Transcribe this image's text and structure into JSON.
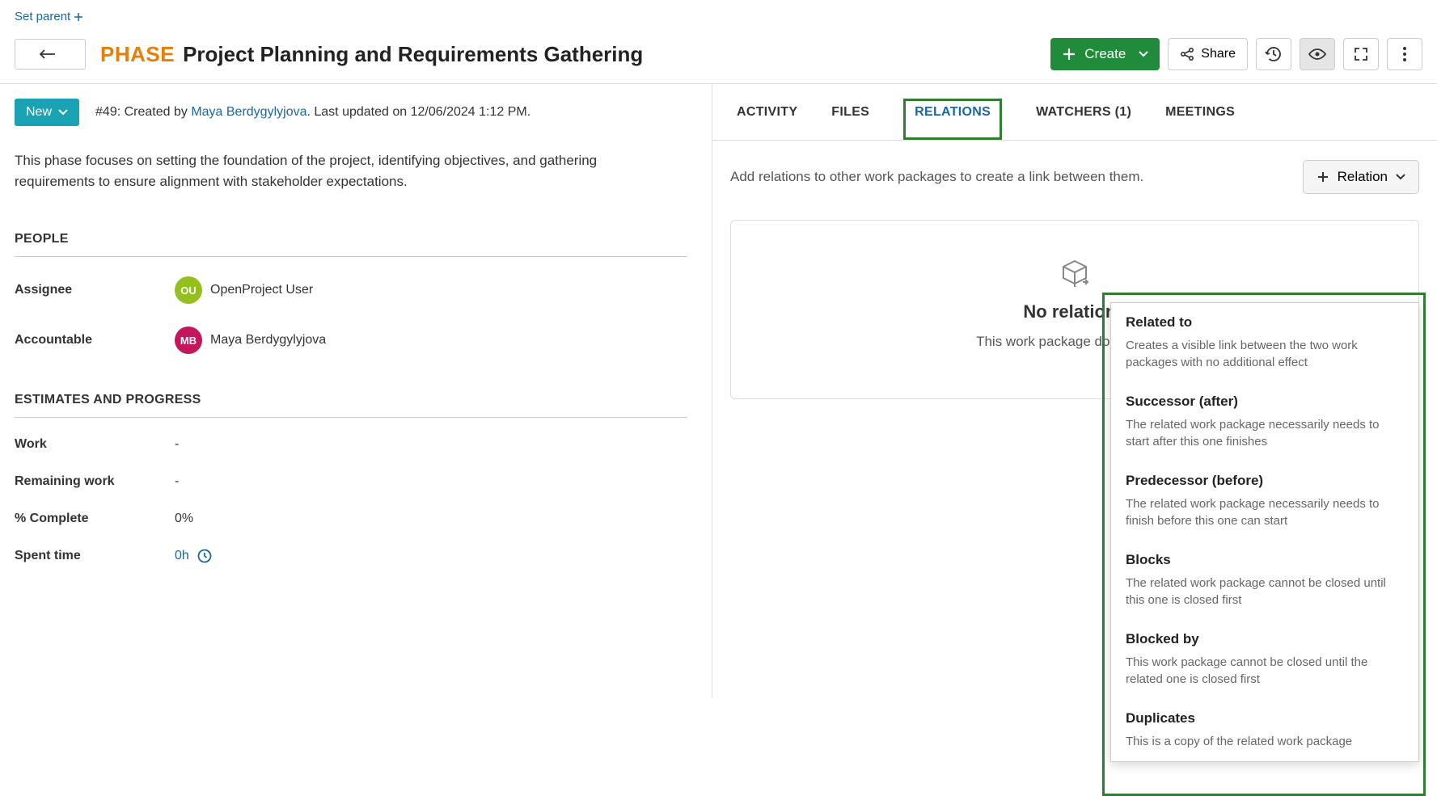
{
  "top": {
    "set_parent": "Set parent"
  },
  "header": {
    "type_label": "PHASE",
    "title": "Project Planning and Requirements Gathering",
    "create_label": "Create",
    "share_label": "Share"
  },
  "status": {
    "label": "New",
    "id_prefix": "#49: Created by ",
    "creator": "Maya Berdygylyjova",
    "updated": ". Last updated on 12/06/2024 1:12 PM."
  },
  "description": "This phase focuses on setting the foundation of the project, identifying objectives, and gathering requirements to ensure alignment with stakeholder expectations.",
  "sections": {
    "people_header": "PEOPLE",
    "assignee_label": "Assignee",
    "assignee_initials": "OU",
    "assignee_name": "OpenProject User",
    "accountable_label": "Accountable",
    "accountable_initials": "MB",
    "accountable_name": "Maya Berdygylyjova",
    "estimates_header": "ESTIMATES AND PROGRESS",
    "work_label": "Work",
    "work_value": "-",
    "remaining_label": "Remaining work",
    "remaining_value": "-",
    "complete_label": "% Complete",
    "complete_value": "0%",
    "spent_label": "Spent time",
    "spent_value": "0h"
  },
  "tabs": {
    "activity": "ACTIVITY",
    "files": "FILES",
    "relations": "RELATIONS",
    "watchers": "WATCHERS (1)",
    "meetings": "MEETINGS"
  },
  "relations": {
    "hint": "Add relations to other work packages to create a link between them.",
    "button_label": "Relation",
    "empty_title": "No relations",
    "empty_text": "This work package does not hav"
  },
  "dropdown": [
    {
      "title": "Related to",
      "desc": "Creates a visible link between the two work packages with no additional effect"
    },
    {
      "title": "Successor (after)",
      "desc": "The related work package necessarily needs to start after this one finishes"
    },
    {
      "title": "Predecessor (before)",
      "desc": "The related work package necessarily needs to finish before this one can start"
    },
    {
      "title": "Blocks",
      "desc": "The related work package cannot be closed until this one is closed first"
    },
    {
      "title": "Blocked by",
      "desc": "This work package cannot be closed until the related one is closed first"
    },
    {
      "title": "Duplicates",
      "desc": "This is a copy of the related work package"
    }
  ]
}
